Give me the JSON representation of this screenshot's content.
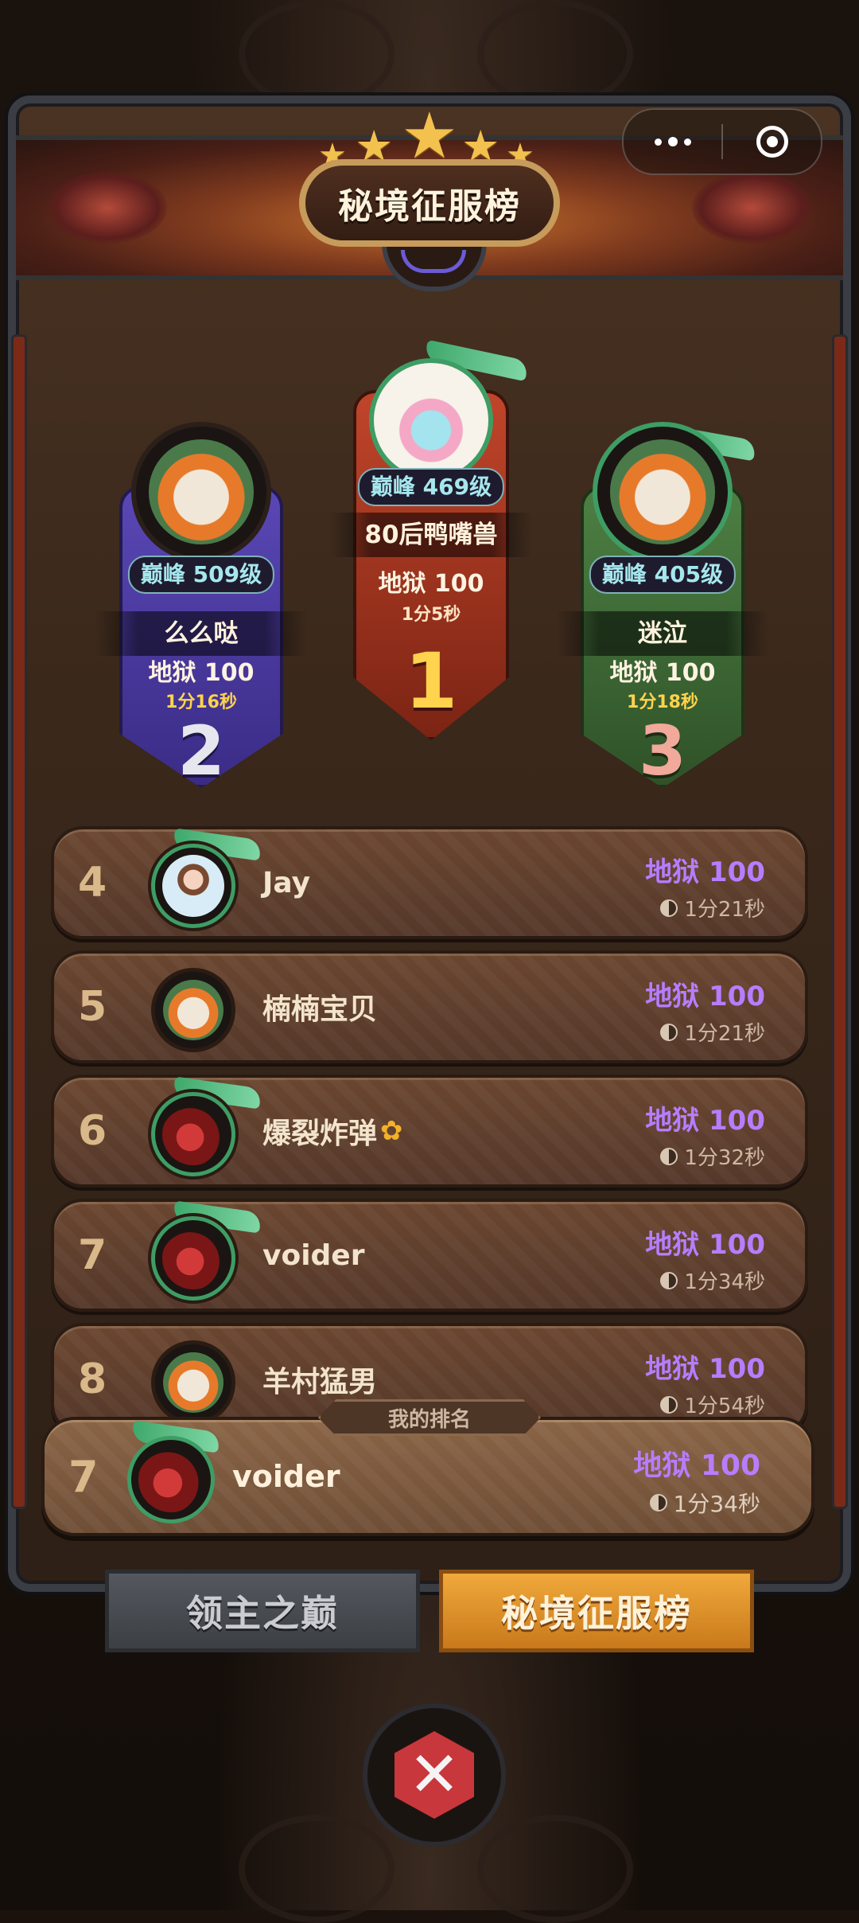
{
  "header": {
    "title": "秘境征服榜",
    "capsule_more_icon": "more-dots-icon",
    "capsule_close_icon": "target-close-icon"
  },
  "podium": [
    {
      "rank": "1",
      "level": "巅峰 469级",
      "name": "80后鸭嘴兽",
      "difficulty": "地狱 100",
      "time": "1分5秒"
    },
    {
      "rank": "2",
      "level": "巅峰 509级",
      "name": "么么哒",
      "difficulty": "地狱 100",
      "time": "1分16秒"
    },
    {
      "rank": "3",
      "level": "巅峰 405级",
      "name": "迷泣",
      "difficulty": "地狱 100",
      "time": "1分18秒"
    }
  ],
  "list": [
    {
      "rank": "4",
      "name": "Jay",
      "difficulty": "地狱 100",
      "time": "1分21秒"
    },
    {
      "rank": "5",
      "name": "楠楠宝贝",
      "difficulty": "地狱 100",
      "time": "1分21秒"
    },
    {
      "rank": "6",
      "name": "爆裂炸弹",
      "difficulty": "地狱 100",
      "time": "1分32秒"
    },
    {
      "rank": "7",
      "name": "voider",
      "difficulty": "地狱 100",
      "time": "1分34秒"
    },
    {
      "rank": "8",
      "name": "羊村猛男",
      "difficulty": "地狱 100",
      "time": "1分54秒"
    }
  ],
  "my_rank": {
    "label": "我的排名",
    "rank": "7",
    "name": "voider",
    "difficulty": "地狱 100",
    "time": "1分34秒"
  },
  "tabs": [
    {
      "label": "领主之巅",
      "active": false
    },
    {
      "label": "秘境征服榜",
      "active": true
    }
  ],
  "colors": {
    "difficulty": "#b77dff",
    "time_yellow": "#ffd34d",
    "tab_active": "#f0a93b",
    "rank1": "#a8321c",
    "rank2": "#4b3a9a",
    "rank3": "#3e6b3a"
  }
}
